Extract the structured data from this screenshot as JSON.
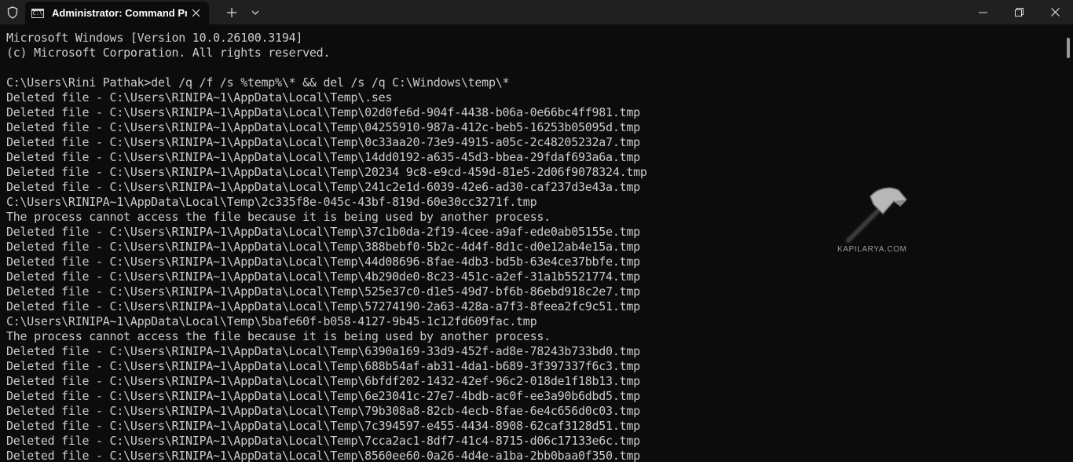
{
  "tab": {
    "title": "Administrator: Command Pro",
    "icon_label": "C:\\"
  },
  "terminal": {
    "lines": [
      "Microsoft Windows [Version 10.0.26100.3194]",
      "(c) Microsoft Corporation. All rights reserved.",
      "",
      "C:\\Users\\Rini Pathak>del /q /f /s %temp%\\* && del /s /q C:\\Windows\\temp\\*",
      "Deleted file - C:\\Users\\RINIPA~1\\AppData\\Local\\Temp\\.ses",
      "Deleted file - C:\\Users\\RINIPA~1\\AppData\\Local\\Temp\\02d0fe6d-904f-4438-b06a-0e66bc4ff981.tmp",
      "Deleted file - C:\\Users\\RINIPA~1\\AppData\\Local\\Temp\\04255910-987a-412c-beb5-16253b05095d.tmp",
      "Deleted file - C:\\Users\\RINIPA~1\\AppData\\Local\\Temp\\0c33aa20-73e9-4915-a05c-2c48205232a7.tmp",
      "Deleted file - C:\\Users\\RINIPA~1\\AppData\\Local\\Temp\\14dd0192-a635-45d3-bbea-29fdaf693a6a.tmp",
      "Deleted file - C:\\Users\\RINIPA~1\\AppData\\Local\\Temp\\20234 9c8-e9cd-459d-81e5-2d06f9078324.tmp",
      "Deleted file - C:\\Users\\RINIPA~1\\AppData\\Local\\Temp\\241c2e1d-6039-42e6-ad30-caf237d3e43a.tmp",
      "C:\\Users\\RINIPA~1\\AppData\\Local\\Temp\\2c335f8e-045c-43bf-819d-60e30cc3271f.tmp",
      "The process cannot access the file because it is being used by another process.",
      "Deleted file - C:\\Users\\RINIPA~1\\AppData\\Local\\Temp\\37c1b0da-2f19-4cee-a9af-ede0ab05155e.tmp",
      "Deleted file - C:\\Users\\RINIPA~1\\AppData\\Local\\Temp\\388bebf0-5b2c-4d4f-8d1c-d0e12ab4e15a.tmp",
      "Deleted file - C:\\Users\\RINIPA~1\\AppData\\Local\\Temp\\44d08696-8fae-4db3-bd5b-63e4ce37bbfe.tmp",
      "Deleted file - C:\\Users\\RINIPA~1\\AppData\\Local\\Temp\\4b290de0-8c23-451c-a2ef-31a1b5521774.tmp",
      "Deleted file - C:\\Users\\RINIPA~1\\AppData\\Local\\Temp\\525e37c0-d1e5-49d7-bf6b-86ebd918c2e7.tmp",
      "Deleted file - C:\\Users\\RINIPA~1\\AppData\\Local\\Temp\\57274190-2a63-428a-a7f3-8feea2fc9c51.tmp",
      "C:\\Users\\RINIPA~1\\AppData\\Local\\Temp\\5bafe60f-b058-4127-9b45-1c12fd609fac.tmp",
      "The process cannot access the file because it is being used by another process.",
      "Deleted file - C:\\Users\\RINIPA~1\\AppData\\Local\\Temp\\6390a169-33d9-452f-ad8e-78243b733bd0.tmp",
      "Deleted file - C:\\Users\\RINIPA~1\\AppData\\Local\\Temp\\688b54af-ab31-4da1-b689-3f397337f6c3.tmp",
      "Deleted file - C:\\Users\\RINIPA~1\\AppData\\Local\\Temp\\6bfdf202-1432-42ef-96c2-018de1f18b13.tmp",
      "Deleted file - C:\\Users\\RINIPA~1\\AppData\\Local\\Temp\\6e23041c-27e7-4bdb-ac0f-ee3a90b6dbd5.tmp",
      "Deleted file - C:\\Users\\RINIPA~1\\AppData\\Local\\Temp\\79b308a8-82cb-4ecb-8fae-6e4c656d0c03.tmp",
      "Deleted file - C:\\Users\\RINIPA~1\\AppData\\Local\\Temp\\7c394597-e455-4434-8908-62caf3128d51.tmp",
      "Deleted file - C:\\Users\\RINIPA~1\\AppData\\Local\\Temp\\7cca2ac1-8df7-41c4-8715-d06c17133e6c.tmp",
      "Deleted file - C:\\Users\\RINIPA~1\\AppData\\Local\\Temp\\8560ee60-0a26-4d4e-a1ba-2bb0baa0f350.tmp"
    ]
  },
  "watermark": {
    "text": "KAPILARYA.COM"
  },
  "colors": {
    "titlebar_bg": "#202020",
    "terminal_bg": "#0c0c0c",
    "terminal_fg": "#cccccc"
  }
}
